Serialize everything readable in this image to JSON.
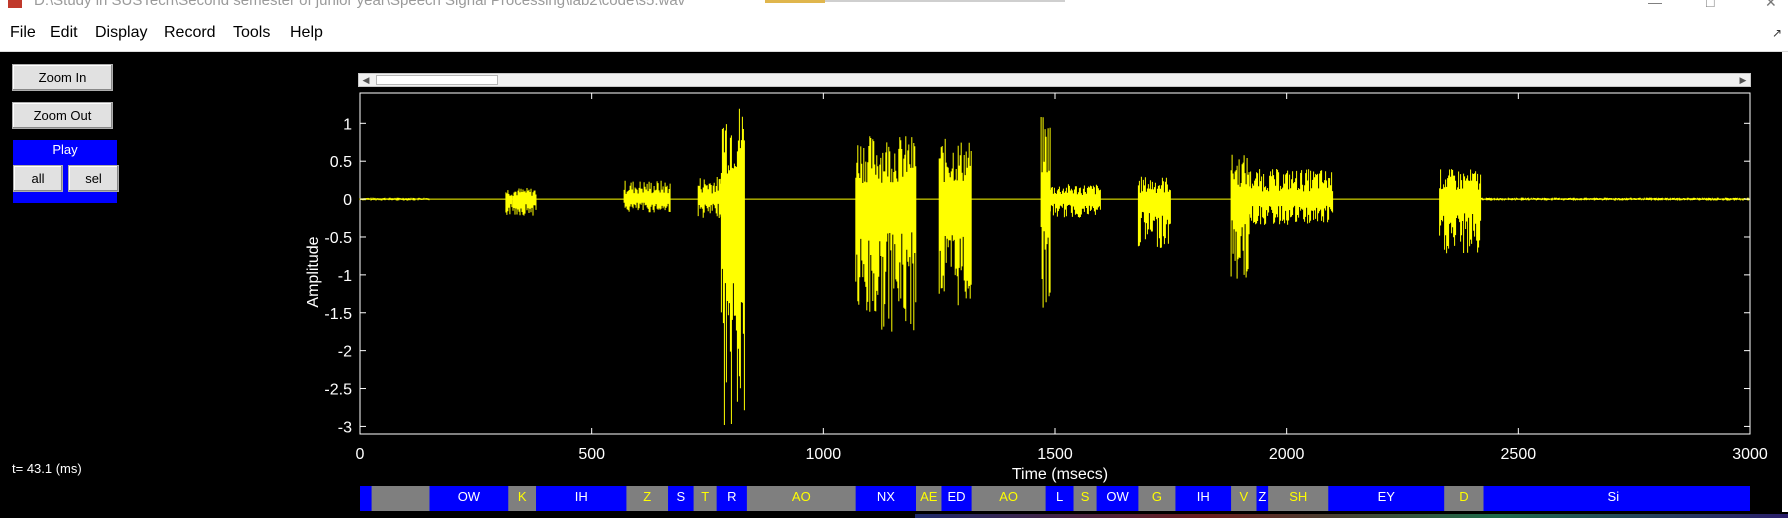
{
  "window": {
    "title": "D:\\Study in SUSTech\\Second semester of junior year\\Speech Signal Processing\\lab2\\code\\s5.wav",
    "controls": [
      "—",
      "□",
      "✕"
    ]
  },
  "menu": [
    "File",
    "Edit",
    "Display",
    "Record",
    "Tools",
    "Help"
  ],
  "left_panel": {
    "zoom_in": "Zoom In",
    "zoom_out": "Zoom Out",
    "play": "Play",
    "all": "all",
    "sel": "sel",
    "t_readout": "t= 43.1 (ms)"
  },
  "chart_data": {
    "type": "line",
    "xlabel": "Time (msecs)",
    "ylabel": "Amplitude",
    "xlim": [
      0,
      3000
    ],
    "ylim": [
      -3.1,
      1.4
    ],
    "xticks": [
      0,
      500,
      1000,
      1500,
      2000,
      2500,
      3000
    ],
    "yticks": [
      1,
      0.5,
      0,
      -0.5,
      -1,
      -1.5,
      -2,
      -2.5,
      -3
    ],
    "line_color": "#ffff00",
    "background": "#000000",
    "bursts": [
      {
        "t0": 0,
        "t1": 150,
        "pos": 0.02,
        "neg": -0.02
      },
      {
        "t0": 315,
        "t1": 380,
        "pos": 0.15,
        "neg": -0.22
      },
      {
        "t0": 570,
        "t1": 670,
        "pos": 0.25,
        "neg": -0.18
      },
      {
        "t0": 730,
        "t1": 780,
        "pos": 0.3,
        "neg": -0.25
      },
      {
        "t0": 780,
        "t1": 830,
        "pos": 1.3,
        "neg": -3.1
      },
      {
        "t0": 1070,
        "t1": 1200,
        "pos": 0.85,
        "neg": -1.75
      },
      {
        "t0": 1250,
        "t1": 1320,
        "pos": 0.8,
        "neg": -1.45
      },
      {
        "t0": 1470,
        "t1": 1490,
        "pos": 1.1,
        "neg": -1.45
      },
      {
        "t0": 1490,
        "t1": 1600,
        "pos": 0.2,
        "neg": -0.25
      },
      {
        "t0": 1680,
        "t1": 1750,
        "pos": 0.3,
        "neg": -0.65
      },
      {
        "t0": 1880,
        "t1": 1920,
        "pos": 0.6,
        "neg": -1.1
      },
      {
        "t0": 1920,
        "t1": 2100,
        "pos": 0.4,
        "neg": -0.35
      },
      {
        "t0": 2330,
        "t1": 2420,
        "pos": 0.4,
        "neg": -0.75
      },
      {
        "t0": 2420,
        "t1": 3000,
        "pos": 0.02,
        "neg": -0.02
      }
    ]
  },
  "phoneme_tier": {
    "colors": {
      "blue": "#0000ff",
      "gray": "#7f7f7f",
      "text": "#ffff00",
      "text_light": "#ffffff"
    },
    "segments": [
      {
        "label": "",
        "t0": 0,
        "t1": 8,
        "color": "blue"
      },
      {
        "label": "",
        "t0": 25,
        "t1": 150,
        "color": "gray"
      },
      {
        "label": "OW",
        "t0": 150,
        "t1": 320,
        "color": "blue"
      },
      {
        "label": "K",
        "t0": 320,
        "t1": 380,
        "color": "gray"
      },
      {
        "label": "IH",
        "t0": 380,
        "t1": 575,
        "color": "blue"
      },
      {
        "label": "Z",
        "t0": 575,
        "t1": 665,
        "color": "gray"
      },
      {
        "label": "S",
        "t0": 665,
        "t1": 720,
        "color": "blue"
      },
      {
        "label": "T",
        "t0": 720,
        "t1": 770,
        "color": "gray"
      },
      {
        "label": "R",
        "t0": 770,
        "t1": 835,
        "color": "blue"
      },
      {
        "label": "AO",
        "t0": 835,
        "t1": 1070,
        "color": "gray"
      },
      {
        "label": "NX",
        "t0": 1070,
        "t1": 1200,
        "color": "blue"
      },
      {
        "label": "AE",
        "t0": 1200,
        "t1": 1255,
        "color": "gray"
      },
      {
        "label": "ED",
        "t0": 1255,
        "t1": 1320,
        "color": "blue"
      },
      {
        "label": "AO",
        "t0": 1320,
        "t1": 1480,
        "color": "gray"
      },
      {
        "label": "L",
        "t0": 1480,
        "t1": 1540,
        "color": "blue"
      },
      {
        "label": "S",
        "t0": 1540,
        "t1": 1590,
        "color": "gray"
      },
      {
        "label": "OW",
        "t0": 1590,
        "t1": 1680,
        "color": "blue"
      },
      {
        "label": "G",
        "t0": 1680,
        "t1": 1760,
        "color": "gray"
      },
      {
        "label": "IH",
        "t0": 1760,
        "t1": 1880,
        "color": "blue"
      },
      {
        "label": "V",
        "t0": 1880,
        "t1": 1935,
        "color": "gray"
      },
      {
        "label": "Z",
        "t0": 1935,
        "t1": 1960,
        "color": "blue"
      },
      {
        "label": "SH",
        "t0": 1960,
        "t1": 2090,
        "color": "gray"
      },
      {
        "label": "EY",
        "t0": 2090,
        "t1": 2340,
        "color": "blue"
      },
      {
        "label": "D",
        "t0": 2340,
        "t1": 2425,
        "color": "gray"
      },
      {
        "label": "Si",
        "t0": 2425,
        "t1": 2985,
        "color": "blue"
      }
    ]
  }
}
